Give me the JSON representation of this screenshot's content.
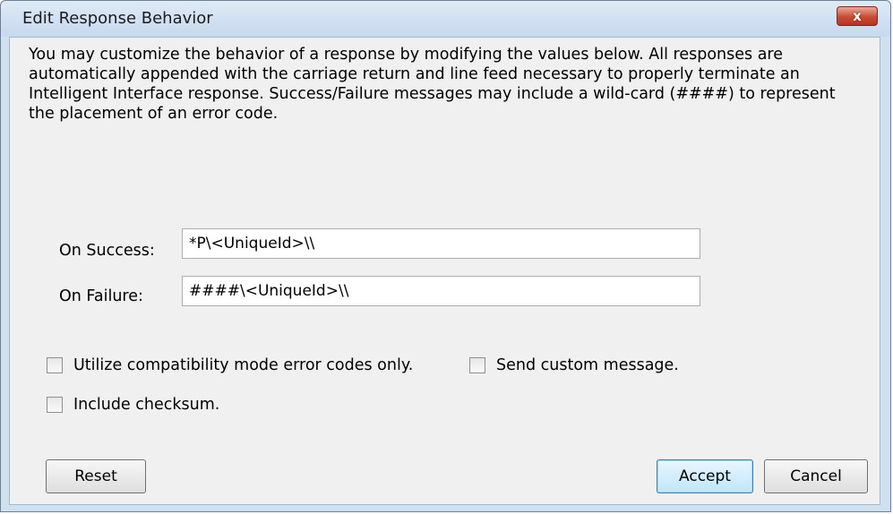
{
  "window": {
    "title": "Edit Response Behavior",
    "close_label": "x"
  },
  "description": "You may customize the behavior of a response by modifying the values below. All responses are automatically appended with the carriage return and line feed necessary to properly terminate an Intelligent Interface response. Success/Failure messages may include a wild-card (####) to represent the placement of an error code.",
  "fields": {
    "success": {
      "label": "On Success:",
      "value": "*P\\<UniqueId>\\\\"
    },
    "failure": {
      "label": "On Failure:",
      "value": "####\\<UniqueId>\\\\"
    }
  },
  "options": {
    "compat_mode": {
      "label": "Utilize compatibility mode error codes only.",
      "checked": false
    },
    "custom_message": {
      "label": "Send custom message.",
      "checked": false
    },
    "checksum": {
      "label": "Include checksum.",
      "checked": false
    }
  },
  "buttons": {
    "reset": "Reset",
    "accept": "Accept",
    "cancel": "Cancel"
  },
  "colors": {
    "titlebar": "#c6d9ee",
    "client_bg": "#f0f0f0",
    "close_button": "#c94b33",
    "default_button_border": "#3c7fb1"
  }
}
